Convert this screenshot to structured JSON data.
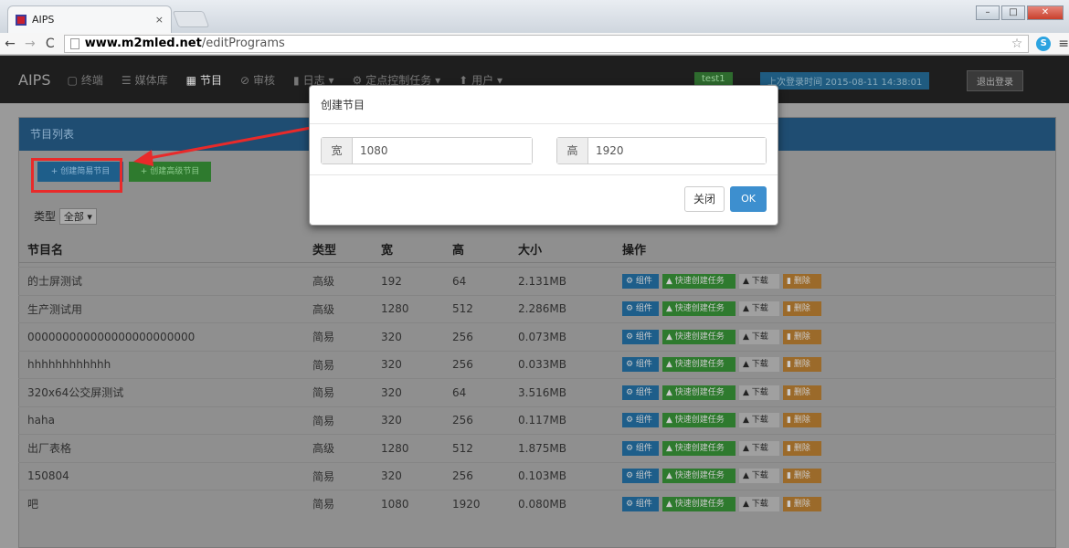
{
  "browser": {
    "tab_title": "AIPS",
    "tab_close": "×",
    "url_host": "www.m2mled.net",
    "url_path": "/editPrograms",
    "win_min": "–",
    "win_max": "□",
    "win_close": "✕"
  },
  "nav": {
    "brand": "AIPS",
    "items": [
      {
        "icon": "▢",
        "label": "终端"
      },
      {
        "icon": "☰",
        "label": "媒体库"
      },
      {
        "icon": "▦",
        "label": "节目"
      },
      {
        "icon": "⊘",
        "label": "审核"
      },
      {
        "icon": "▮",
        "label": "日志 ▾"
      },
      {
        "icon": "⚙",
        "label": "定点控制任务 ▾"
      },
      {
        "icon": "⬆",
        "label": "用户 ▾"
      }
    ],
    "user_badge": "test1",
    "login_badge": "上次登录时间 2015-08-11 14:38:01",
    "logout": "退出登录"
  },
  "panel": {
    "title": "节目列表",
    "btn_create_simple": "+ 创建简易节目",
    "btn_create_advanced": "+ 创建高级节目",
    "type_label": "类型",
    "type_value": "全部 ▾"
  },
  "table": {
    "headers": {
      "name": "节目名",
      "type": "类型",
      "width": "宽",
      "height": "高",
      "size": "大小",
      "ops": "操作"
    },
    "op_labels": {
      "edit": "⚙ 组件",
      "task": "▲ 快速创建任务",
      "download": "▲ 下载",
      "delete": "▮ 删除"
    },
    "rows": [
      {
        "name": "的士屏测试",
        "type": "高级",
        "width": "192",
        "height": "64",
        "size": "2.131MB"
      },
      {
        "name": "生产测试用",
        "type": "高级",
        "width": "1280",
        "height": "512",
        "size": "2.286MB"
      },
      {
        "name": "000000000000000000000000",
        "type": "简易",
        "width": "320",
        "height": "256",
        "size": "0.073MB"
      },
      {
        "name": "hhhhhhhhhhhh",
        "type": "简易",
        "width": "320",
        "height": "256",
        "size": "0.033MB"
      },
      {
        "name": "320x64公交屏测试",
        "type": "简易",
        "width": "320",
        "height": "64",
        "size": "3.516MB"
      },
      {
        "name": "haha",
        "type": "简易",
        "width": "320",
        "height": "256",
        "size": "0.117MB"
      },
      {
        "name": "出厂表格",
        "type": "高级",
        "width": "1280",
        "height": "512",
        "size": "1.875MB"
      },
      {
        "name": "150804",
        "type": "简易",
        "width": "320",
        "height": "256",
        "size": "0.103MB"
      },
      {
        "name": "吧",
        "type": "简易",
        "width": "1080",
        "height": "1920",
        "size": "0.080MB"
      }
    ]
  },
  "modal": {
    "title": "创建节目",
    "width_label": "宽",
    "width_value": "1080",
    "height_label": "高",
    "height_value": "1920",
    "close_label": "关闭",
    "ok_label": "OK"
  },
  "colors": {
    "annotation": "#e82a2a",
    "primary": "#3d8fcf",
    "success": "#2e7a2e"
  }
}
